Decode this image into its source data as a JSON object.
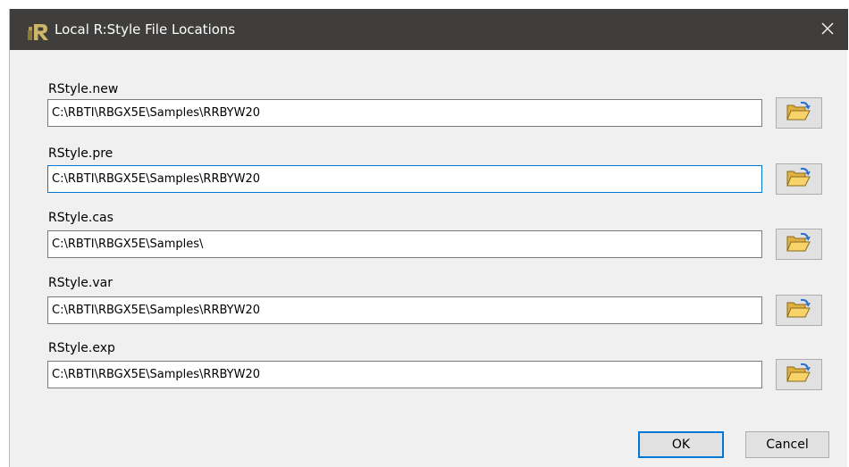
{
  "window": {
    "title": "Local R:Style File Locations"
  },
  "fields": [
    {
      "label": "RStyle.new",
      "value": "C:\\RBTI\\RBGX5E\\Samples\\RRBYW20"
    },
    {
      "label": "RStyle.pre",
      "value": "C:\\RBTI\\RBGX5E\\Samples\\RRBYW20"
    },
    {
      "label": "RStyle.cas",
      "value": "C:\\RBTI\\RBGX5E\\Samples\\"
    },
    {
      "label": "RStyle.var",
      "value": "C:\\RBTI\\RBGX5E\\Samples\\RRBYW20"
    },
    {
      "label": "RStyle.exp",
      "value": "C:\\RBTI\\RBGX5E\\Samples\\RRBYW20"
    }
  ],
  "buttons": {
    "ok_label": "OK",
    "cancel_label": "Cancel"
  },
  "icons": {
    "app": "app-r-logo-icon",
    "close": "close-icon",
    "browse": "open-folder-icon"
  },
  "colors": {
    "titlebar": "#3f3e3c",
    "dialog_background": "#f0f0f0",
    "focus_accent": "#0078d7"
  }
}
